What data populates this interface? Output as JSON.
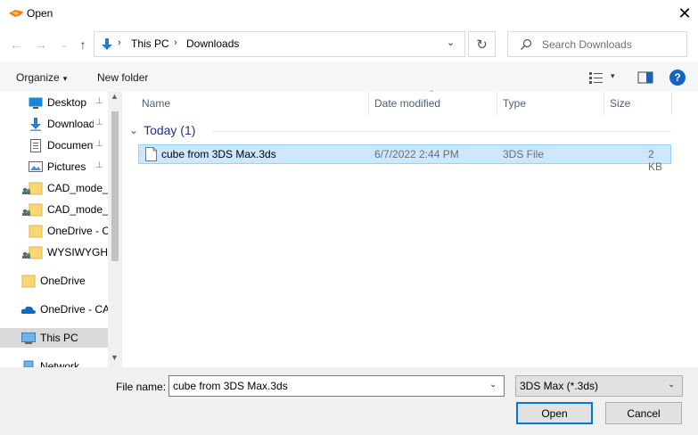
{
  "window": {
    "title": "Open",
    "close_glyph": "✕"
  },
  "nav": {
    "back_glyph": "←",
    "forward_glyph": "→",
    "recent_glyph": "⌄",
    "up_glyph": "↑"
  },
  "address": {
    "crumbs": [
      "This PC",
      "Downloads"
    ],
    "sep_glyph": "›",
    "dropdown_glyph": "⌄",
    "refresh_glyph": "↻"
  },
  "search": {
    "placeholder": "Search Downloads"
  },
  "commandbar": {
    "organize_label": "Organize",
    "caret_glyph": "▾",
    "new_folder_label": "New folder",
    "help_glyph": "?"
  },
  "navpane": {
    "items": [
      {
        "label": "Desktop",
        "icon": "desktop-icon",
        "pinned": true
      },
      {
        "label": "Downloads",
        "icon": "download-icon",
        "pinned": true
      },
      {
        "label": "Documents",
        "icon": "document-icon",
        "pinned": true
      },
      {
        "label": "Pictures",
        "icon": "pictures-icon",
        "pinned": true
      },
      {
        "label": "CAD_mode_",
        "icon": "shared-folder-icon",
        "pinned": false
      },
      {
        "label": "CAD_mode_",
        "icon": "shared-folder-icon",
        "pinned": false
      },
      {
        "label": "OneDrive - C",
        "icon": "folder-icon",
        "pinned": false
      },
      {
        "label": "WYSIWYGHe",
        "icon": "shared-folder-icon",
        "pinned": false
      },
      {
        "label": "OneDrive",
        "icon": "folder-icon",
        "pinned": false
      },
      {
        "label": "OneDrive - CA",
        "icon": "cloud-icon",
        "pinned": false
      },
      {
        "label": "This PC",
        "icon": "this-pc-icon",
        "pinned": false,
        "selected": true
      },
      {
        "label": "Network",
        "icon": "network-icon",
        "pinned": false
      }
    ],
    "pin_glyph": "📌",
    "scroll_up_glyph": "▲",
    "scroll_down_glyph": "▼"
  },
  "filelist": {
    "columns": [
      "Name",
      "Date modified",
      "Type",
      "Size"
    ],
    "sort_glyph": "⌃",
    "group": {
      "label": "Today (1)",
      "collapse_glyph": "⌄"
    },
    "rows": [
      {
        "name": "cube from 3DS Max.3ds",
        "date": "6/7/2022 2:44 PM",
        "type": "3DS File",
        "size": "2 KB"
      }
    ]
  },
  "bottom": {
    "file_name_label": "File name:",
    "file_name_value": "cube from 3DS Max.3ds",
    "dropdown_glyph": "⌄",
    "file_type_value": "3DS Max (*.3ds)",
    "open_label": "Open",
    "cancel_label": "Cancel"
  },
  "colors": {
    "accent": "#0078d7",
    "selection_bg": "#cce8ff",
    "selection_border": "#99d1ff",
    "group_header": "#1e3287",
    "column_header": "#4c607a"
  }
}
